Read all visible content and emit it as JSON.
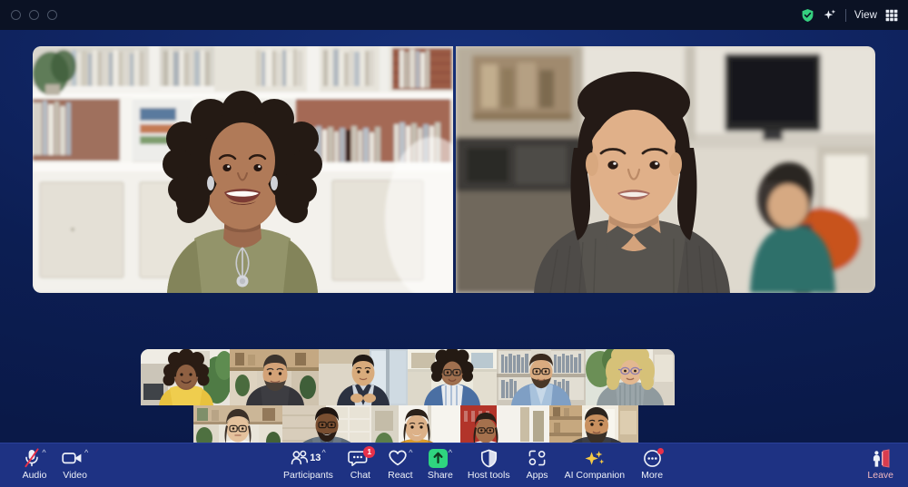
{
  "window": {
    "traffic_lights": [
      "close",
      "minimize",
      "maximize"
    ],
    "titlebar": {
      "encryption_icon": "shield-check-icon",
      "ai_icon": "sparkle-icon",
      "view_label": "View",
      "view_grid_icon": "grid-icon"
    }
  },
  "stage": {
    "main_tiles": [
      {
        "name": "speaker-tile-1",
        "participant": "woman-curly-hair-olive-top",
        "bg_scene": "white bookshelf home office"
      },
      {
        "name": "speaker-tile-2",
        "participant": "woman-dark-bob-grey-top",
        "bg_scene": "open plan office"
      }
    ],
    "filmstrip": {
      "row1": [
        {
          "participant": "woman-yellow-sweater-plants"
        },
        {
          "participant": "man-beard-grey-tshirt-kitchen"
        },
        {
          "participant": "man-suit-window-office"
        },
        {
          "participant": "woman-glasses-curly-striped-shirt"
        },
        {
          "participant": "man-glasses-blue-shirt-bookshelf"
        },
        {
          "participant": "woman-blonde-glasses-striped-shirt"
        }
      ],
      "row2": [
        {
          "participant": "woman-glasses-polkadot-blouse"
        },
        {
          "participant": "man-glasses-grey-shirt-brick"
        },
        {
          "participant": "woman-mustard-top-white-room"
        },
        {
          "participant": "woman-laptop-red-wall"
        },
        {
          "participant": "man-beard-dark-tshirt-shelves"
        }
      ]
    }
  },
  "toolbar": {
    "left": [
      {
        "name": "audio-button",
        "label": "Audio",
        "icon": "microphone-muted-icon",
        "has_chevron": true,
        "muted": true
      },
      {
        "name": "video-button",
        "label": "Video",
        "icon": "camera-icon",
        "has_chevron": true
      }
    ],
    "center": [
      {
        "name": "participants-button",
        "label": "Participants",
        "icon": "people-icon",
        "count": "13",
        "has_chevron": true
      },
      {
        "name": "chat-button",
        "label": "Chat",
        "icon": "chat-bubble-icon",
        "badge": "1",
        "has_chevron": true
      },
      {
        "name": "react-button",
        "label": "React",
        "icon": "heart-icon",
        "has_chevron": true
      },
      {
        "name": "share-button",
        "label": "Share",
        "icon": "share-screen-icon",
        "has_chevron": true
      },
      {
        "name": "host-tools-button",
        "label": "Host tools",
        "icon": "shield-icon"
      },
      {
        "name": "apps-button",
        "label": "Apps",
        "icon": "apps-icon"
      },
      {
        "name": "ai-companion-button",
        "label": "AI Companion",
        "icon": "ai-sparkles-icon"
      },
      {
        "name": "more-button",
        "label": "More",
        "icon": "more-circle-icon",
        "dot_badge": true
      }
    ],
    "right": [
      {
        "name": "leave-button",
        "label": "Leave",
        "icon": "leave-door-icon"
      }
    ]
  },
  "colors": {
    "titlebar_bg": "#0b1224",
    "stage_bg": "#102563",
    "toolbar_bg": "#1e3283",
    "accent_green": "#2fd57f",
    "badge_red": "#e8314a",
    "leave_red": "#d93c4e",
    "ai_yellow": "#f5c945",
    "encryption_green": "#35d07f"
  }
}
